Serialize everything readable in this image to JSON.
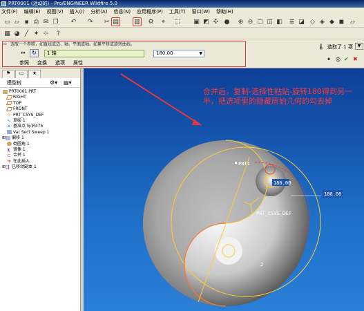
{
  "window": {
    "title": "PRT0001 (活动的) - Pro/ENGINEER Wildfire 5.0"
  },
  "menu": [
    "文件(F)",
    "编辑(E)",
    "视图(V)",
    "插入(I)",
    "分析(A)",
    "信息(N)",
    "应用程序(P)",
    "工具(T)",
    "窗口(W)",
    "帮助(H)"
  ],
  "dashboard": {
    "prompt": "选取一个参照，如直线或边、轴、平面或轴。如果平移或旋转曲线。",
    "axis_field": "1 轴",
    "angle_value": "180.00",
    "tabs": [
      "参照",
      "变换",
      "选项",
      "属性"
    ],
    "select_label": "选取了 1 项"
  },
  "model_tree": {
    "header": "模型树",
    "items": [
      "PRT0001.PRT",
      "RIGHT",
      "TOP",
      "FRONT",
      "PRT_CSYS_DEF",
      "草绘 1",
      "基准点 标识475",
      "Var Sect Sweep 1",
      "偏移 1",
      "倒圆角 1",
      "镜像 1",
      "合并 1",
      "在此插入",
      "已移动副本 1"
    ]
  },
  "viewport": {
    "annotation": "合并后，复制-选择性粘贴-旋转180得到另一半，把选项里的隐藏原始几何的勾去掉",
    "labels": {
      "pnt": "PNT1",
      "dim1": "180.00",
      "dim2": "180.00",
      "csys": "PRT_CSYS_DEF",
      "marker": "2"
    }
  }
}
